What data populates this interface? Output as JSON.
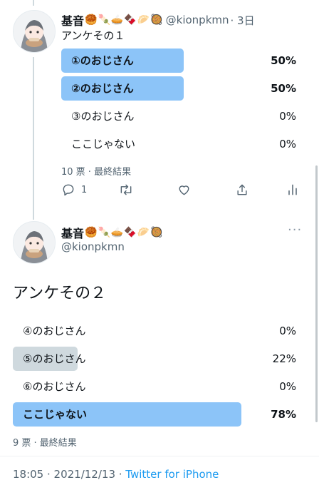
{
  "tweet1": {
    "display_name": "基音",
    "emojis": [
      "🥮",
      "🍡",
      "🥧",
      "🍫",
      "🥟",
      "🥘"
    ],
    "handle": "@kionpkmn",
    "time": "· 3日",
    "text": "アンケその１",
    "poll": {
      "options": [
        {
          "label": "①のおじさん",
          "percent": "50%",
          "fraction": 0.5,
          "winner": true
        },
        {
          "label": "②のおじさん",
          "percent": "50%",
          "fraction": 0.5,
          "winner": true
        },
        {
          "label": "③のおじさん",
          "percent": "0%",
          "fraction": 0,
          "winner": false
        },
        {
          "label": "ここじゃない",
          "percent": "0%",
          "fraction": 0,
          "winner": false
        }
      ],
      "summary": "10 票 · 最終結果"
    },
    "actions": {
      "reply_count": "1"
    }
  },
  "tweet2": {
    "display_name": "基音",
    "emojis": [
      "🥮",
      "🍡",
      "🥧",
      "🍫",
      "🥟",
      "🥘"
    ],
    "handle": "@kionpkmn",
    "text": "アンケその２",
    "poll": {
      "options": [
        {
          "label": "④のおじさん",
          "percent": "0%",
          "fraction": 0,
          "winner": false
        },
        {
          "label": "⑤のおじさん",
          "percent": "22%",
          "fraction": 0.22,
          "winner": false
        },
        {
          "label": "⑥のおじさん",
          "percent": "0%",
          "fraction": 0,
          "winner": false
        },
        {
          "label": "ここじゃない",
          "percent": "78%",
          "fraction": 0.78,
          "winner": true
        }
      ],
      "summary": "9 票 · 最終結果"
    },
    "timestamp": "18:05 · 2021/12/13 · ",
    "source": "Twitter for iPhone"
  },
  "colors": {
    "winner_bar": "#8cc4f8",
    "other_bar": "#cfd9de",
    "link": "#1d9bf0",
    "muted": "#536471"
  }
}
